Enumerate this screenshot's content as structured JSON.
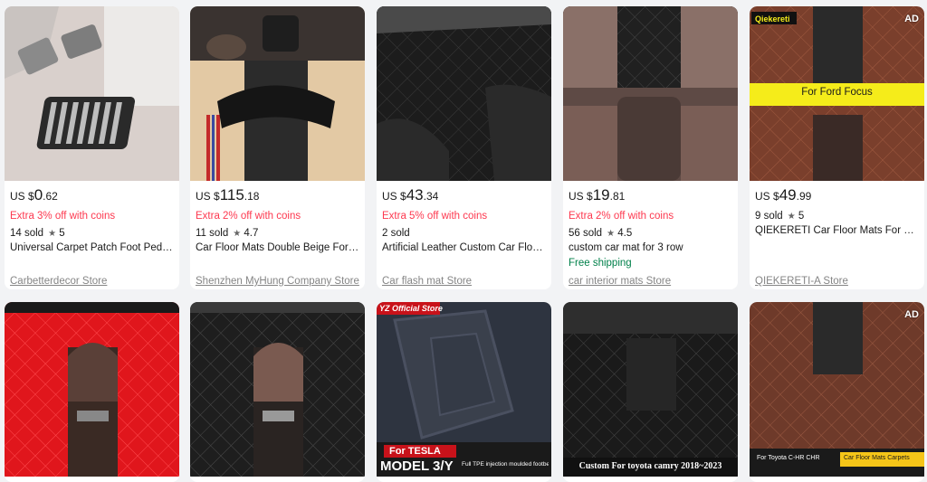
{
  "products": [
    {
      "price_currency": "US $",
      "price_int": "0",
      "price_dec": ".62",
      "extra": "Extra 3% off with coins",
      "sold": "14 sold",
      "rating": "5",
      "title": "Universal Carpet Patch Foot Pedal Pad Heel Plate",
      "shipping": "",
      "store": "Carbetterdecor Store",
      "ad": ""
    },
    {
      "price_currency": "US $",
      "price_int": "115",
      "price_dec": ".18",
      "extra": "Extra 2% off with coins",
      "sold": "11 sold",
      "rating": "4.7",
      "title": "Car Floor Mats Double Beige For Golf",
      "shipping": "",
      "store": "Shenzhen MyHung Company Store",
      "ad": ""
    },
    {
      "price_currency": "US $",
      "price_int": "43",
      "price_dec": ".34",
      "extra": "Extra 5% off with coins",
      "sold": "2 sold",
      "rating": "",
      "title": "Artificial Leather Custom Car Floor Mats",
      "shipping": "",
      "store": "Car flash mat Store",
      "ad": ""
    },
    {
      "price_currency": "US $",
      "price_int": "19",
      "price_dec": ".81",
      "extra": "Extra 2% off with coins",
      "sold": "56 sold",
      "rating": "4.5",
      "title": "custom car mat for 3 row",
      "shipping": "Free shipping",
      "store": "car interior mats Store",
      "ad": ""
    },
    {
      "price_currency": "US $",
      "price_int": "49",
      "price_dec": ".99",
      "extra": "",
      "sold": "9 sold",
      "rating": "5",
      "title": "QIEKERETI Car Floor Mats For Ford Focus",
      "shipping": "",
      "store": "QIEKERETI-A Store",
      "ad": "AD",
      "banner_brand": "Qiekereti",
      "banner_text": "For Ford Focus"
    },
    {
      "ad": ""
    },
    {
      "ad": ""
    },
    {
      "ad": "",
      "banner_brand": "YZ Official Store",
      "banner_line1": "For TESLA",
      "banner_line2": "MODEL 3/Y",
      "banner_small": "Full TPE injection moulded footbed"
    },
    {
      "ad": "",
      "banner_text": "Custom For toyota camry 2018~2023"
    },
    {
      "ad": "AD",
      "banner_left": "For Toyota C-HR CHR",
      "banner_right": "Car Floor Mats Carpets"
    }
  ],
  "star_glyph": "★",
  "colors": {
    "discount": "#fd384f",
    "shipping": "#00804a",
    "store": "#858585",
    "text": "#191919",
    "background": "#f2f3f5"
  }
}
